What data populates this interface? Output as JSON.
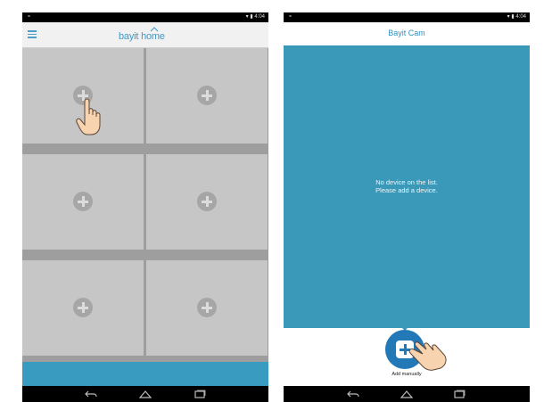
{
  "status_bar": {
    "left_icon": "notification-dot",
    "right_text": "▾ ▮ 4:04"
  },
  "left_screen": {
    "logo": {
      "text": "bayit home"
    },
    "tiles": [
      {
        "name": "add-camera-slot-1",
        "icon": "plus-circle-icon"
      },
      {
        "name": "add-camera-slot-2",
        "icon": "plus-circle-icon"
      },
      {
        "name": "add-camera-slot-3",
        "icon": "plus-circle-icon"
      },
      {
        "name": "add-camera-slot-4",
        "icon": "plus-circle-icon"
      },
      {
        "name": "add-camera-slot-5",
        "icon": "plus-circle-icon"
      },
      {
        "name": "add-camera-slot-6",
        "icon": "plus-circle-icon"
      }
    ]
  },
  "right_screen": {
    "title": "Bayit Cam",
    "empty_line1": "No device on the list.",
    "empty_line2": "Please add a device.",
    "add_label": "Add manually"
  },
  "nav": {
    "back": "back-icon",
    "home": "home-icon",
    "recents": "recents-icon"
  },
  "colors": {
    "accent": "#3a9bc1",
    "add_button": "#2379b7",
    "tile": "#c6c6c6",
    "grid_gap": "#9e9e9e"
  }
}
